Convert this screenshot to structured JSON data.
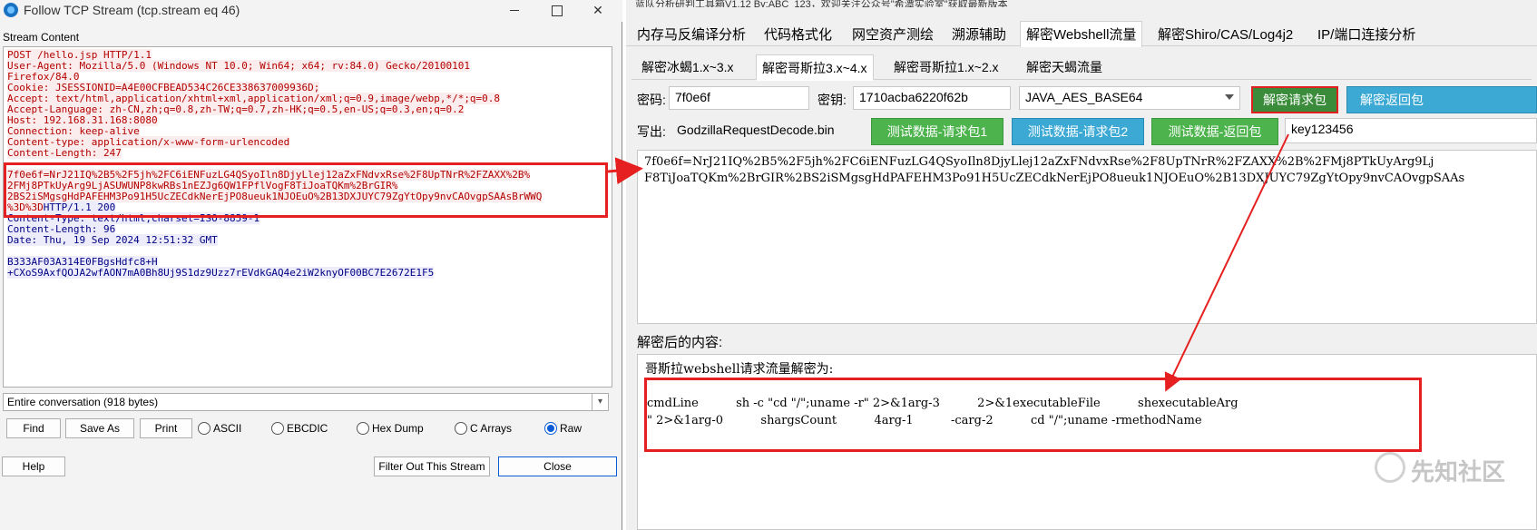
{
  "wireshark": {
    "title": "Follow TCP Stream (tcp.stream eq 46)",
    "group_label": "Stream Content",
    "request_lines_a": [
      "POST /hello.jsp HTTP/1.1",
      "User-Agent: Mozilla/5.0 (Windows NT 10.0; Win64; x64; rv:84.0) Gecko/20100101",
      "Firefox/84.0",
      "Cookie: JSESSIONID=A4E00CFBEAD534C26CE338637009936D;",
      "Accept: text/html,application/xhtml+xml,application/xml;q=0.9,image/webp,*/*;q=0.8",
      "Accept-Language: zh-CN,zh;q=0.8,zh-TW;q=0.7,zh-HK;q=0.5,en-US;q=0.3,en;q=0.2",
      "Host: 192.168.31.168:8080",
      "Connection: keep-alive",
      "Content-type: application/x-www-form-urlencoded",
      "Content-Length: 247"
    ],
    "request_lines_b": [
      "7f0e6f=NrJ21IQ%2B5%2F5jh%2FC6iENFuzLG4QSyoIln8DjyLlej12aZxFNdvxRse%2F8UpTNrR%2FZAXX%2B%",
      "2FMj8PTkUyArg9LjASUWUNP8kwRBs1nEZJg6QW1FPflVogF8TiJoaTQKm%2BrGIR%",
      "2BS2iSMgsgHdPAFEHM3Po91H5UcZECdkNerEjPO8ueuk1NJOEuO%2B13DXJUYC79ZgYtOpy9nvCAOvgpSAAsBrWWQ"
    ],
    "mixed_line_request": "%3D%3D",
    "mixed_line_response": "HTTP/1.1 200",
    "response_lines_a": [
      "Content-Type: text/html;charset=ISO-8859-1",
      "Content-Length: 96",
      "Date: Thu, 19 Sep 2024 12:51:32 GMT"
    ],
    "response_lines_b": [
      "B333AF03A314E0FBgsHdfc8+H",
      "+CXoS9AxfQOJA2wfAON7mA0Bh8Uj9S1dz9Uzz7rEVdkGAQ4e2iW2knyOF00BC7E2672E1F5"
    ],
    "conversation": "Entire conversation (918 bytes)",
    "buttons": {
      "find": "Find",
      "save_as": "Save As",
      "print": "Print",
      "help": "Help",
      "filter_out": "Filter Out This Stream",
      "close": "Close"
    },
    "formats": [
      "ASCII",
      "EBCDIC",
      "Hex Dump",
      "C Arrays",
      "Raw"
    ],
    "selected_format": "Raw"
  },
  "tool": {
    "title_partial": "蓝队分析研判工具箱V1.12 By:ABC_123，欢迎关注公众号\"希潭实验室\"获取最新版本",
    "main_tabs": [
      "内存马反编译分析",
      "代码格式化",
      "网空资产测绘",
      "溯源辅助",
      "解密Webshell流量",
      "解密Shiro/CAS/Log4j2",
      "IP/端口连接分析"
    ],
    "active_main_tab": "解密Webshell流量",
    "sub_tabs": [
      "解密冰蝎1.x~3.x",
      "解密哥斯拉3.x~4.x",
      "解密哥斯拉1.x~2.x",
      "解密天蝎流量"
    ],
    "active_sub_tab": "解密哥斯拉3.x~4.x",
    "password_label": "密码:",
    "password_value": "7f0e6f",
    "key_label": "密钥:",
    "key_value": "1710acba6220f62b",
    "algorithm": "JAVA_AES_BASE64",
    "decrypt_request_button": "解密请求包",
    "decrypt_response_button": "解密返回包",
    "write_label": "写出:",
    "write_file": "GodzillaRequestDecode.bin",
    "test_request1_button": "测试数据-请求包1",
    "test_request2_button": "测试数据-请求包2",
    "test_response_button": "测试数据-返回包",
    "key_field_value": "key123456",
    "payload_lines": [
      "7f0e6f=NrJ21IQ%2B5%2F5jh%2FC6iENFuzLG4QSyoIln8DjyLlej12aZxFNdvxRse%2F8UpTNrR%2FZAXX%2B%2FMj8PTkUyArg9Lj",
      "F8TiJoaTQKm%2BrGIR%2BS2iSMgsgHdPAFEHM3Po91H5UcZECdkNerEjPO8ueuk1NJOEuO%2B13DXJUYC79ZgYtOpy9nvCAOvgpSAAs"
    ],
    "decrypted_label": "解密后的内容:",
    "result_heading": "哥斯拉webshell请求流量解密为:",
    "result_lines": [
      "cmdLine          sh -c \"cd \"/\";uname -r\" 2>&1arg-3          2>&1executableFile          shexecutableArg",
      "\" 2>&1arg-0          shargsCount          4arg-1          -carg-2          cd \"/\";uname -rmethodName"
    ]
  },
  "watermark": "先知社区",
  "colors": {
    "annotation_red": "#e62020",
    "request_text": "#b40000",
    "response_text": "#000084",
    "button_green": "#4db34d",
    "button_blue": "#3ba9d4"
  }
}
